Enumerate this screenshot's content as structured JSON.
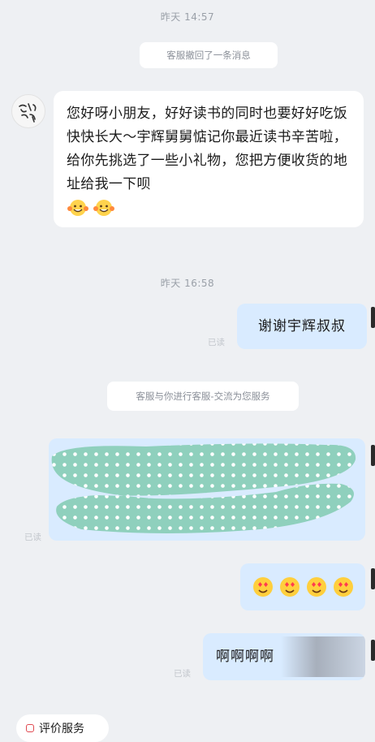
{
  "chat": {
    "time1": "昨天 14:57",
    "recall_notice": "客服撤回了一条消息",
    "incoming_message": "您好呀小朋友，好好读书的同时也要好好吃饭快快长大～宇辉舅舅惦记你最近读书辛苦啦，给你先挑选了一些小礼物，您把方便收货的地址给我一下呗",
    "incoming_emojis": [
      "grinning-face-emoji",
      "grinning-face-emoji"
    ],
    "time2": "昨天 16:58",
    "outgoing_thanks": "谢谢宇辉叔叔",
    "read_status_1": "已读",
    "notice2": "客服与你进行客服-交流为您服务",
    "read_status_2": "已读",
    "outgoing_emojis": [
      "heart-eyes-emoji",
      "heart-eyes-emoji",
      "heart-eyes-emoji",
      "heart-eyes-emoji"
    ],
    "outgoing_last": "啊啊啊啊",
    "read_status_3": "已读",
    "bottom_button": "评价服务"
  },
  "colors": {
    "background": "#eef0f3",
    "incoming_bubble": "#ffffff",
    "outgoing_bubble": "#d9ebff",
    "redaction_fill": "#8fd0bd",
    "redaction_dots": "#ffffff"
  }
}
